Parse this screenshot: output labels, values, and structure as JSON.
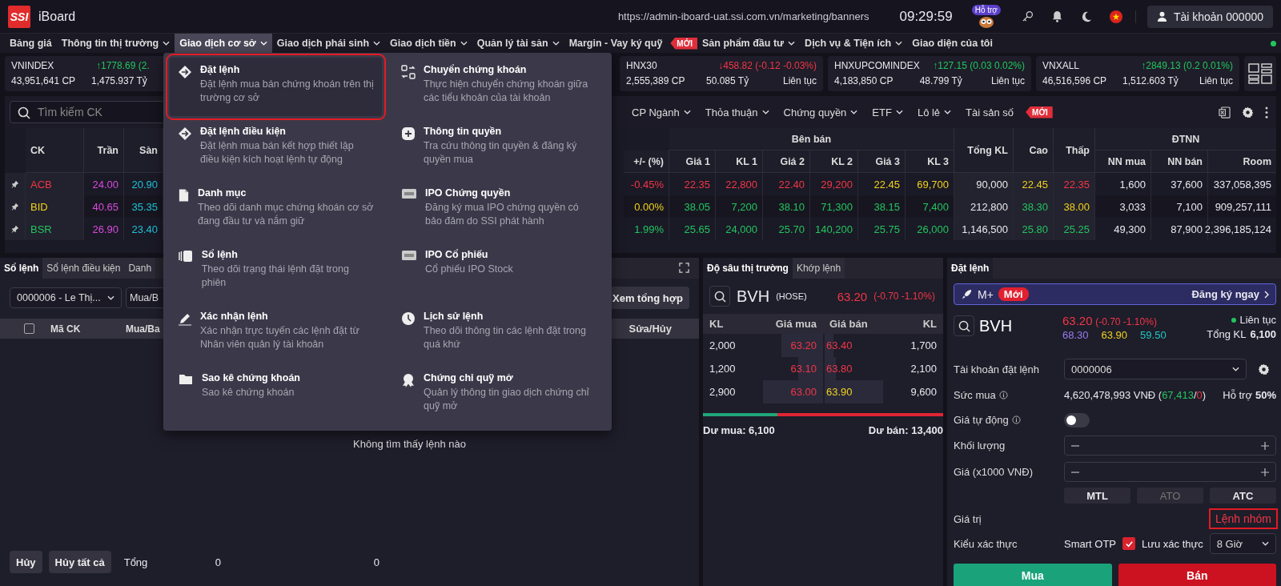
{
  "header": {
    "logo": "SSI",
    "app_name": "iBoard",
    "url": "https://admin-iboard-uat.ssi.com.vn/marketing/banners",
    "time": "09:29:59",
    "support_label": "Hỗ trợ",
    "account": "Tài khoản 000000"
  },
  "nav": [
    {
      "label": "Bảng giá",
      "dropdown": false,
      "selected": false
    },
    {
      "label": "Thông tin thị trường",
      "dropdown": true,
      "selected": false
    },
    {
      "label": "Giao dịch cơ sở",
      "dropdown": true,
      "selected": true
    },
    {
      "label": "Giao dịch phái sinh",
      "dropdown": true,
      "selected": false
    },
    {
      "label": "Giao dịch tiền",
      "dropdown": true,
      "selected": false
    },
    {
      "label": "Quản lý tài sản",
      "dropdown": true,
      "selected": false
    },
    {
      "label": "Margin - Vay ký quỹ",
      "dropdown": false,
      "selected": false,
      "badge": "MỚI"
    },
    {
      "label": "Sản phẩm đầu tư",
      "dropdown": true,
      "selected": false
    },
    {
      "label": "Dịch vụ & Tiện ích",
      "dropdown": true,
      "selected": false
    },
    {
      "label": "Giao diện của tôi",
      "dropdown": false,
      "selected": false
    }
  ],
  "indices": [
    {
      "name": "VNINDEX",
      "change": "↑1778.69 (2.",
      "color": "#22c55e",
      "volume": "43,951,641 CP",
      "value": "1,475.937 Tỷ"
    },
    {
      "name": "HNX30",
      "change": "↓458.82 (-0.12 -0.03%)",
      "color": "#f23645",
      "volume": "2,555,389 CP",
      "value": "50.085 Tỷ",
      "session": "Liên tục"
    },
    {
      "name": "HNXUPCOMINDEX",
      "change": "↑127.15 (0.03 0.02%)",
      "color": "#22c55e",
      "volume": "4,183,850 CP",
      "value": "48.799 Tỷ",
      "session": "Liên tục"
    },
    {
      "name": "VNXALL",
      "change": "↑2849.13 (0.2 0.01%)",
      "color": "#22c55e",
      "volume": "46,516,596 CP",
      "value": "1,512.603 Tỷ",
      "session": "Liên tục"
    }
  ],
  "board_toolbar": {
    "search_placeholder": "Tìm kiếm CK",
    "filters": [
      {
        "label": "CP Ngành",
        "dropdown": true
      },
      {
        "label": "Thỏa thuận",
        "dropdown": true
      },
      {
        "label": "Chứng quyền",
        "dropdown": true
      },
      {
        "label": "ETF",
        "dropdown": true
      },
      {
        "label": "Lô lẻ",
        "dropdown": true
      },
      {
        "label": "Tài sản số",
        "dropdown": false,
        "badge": "MỚI"
      }
    ]
  },
  "price_table": {
    "left_columns": [
      "CK",
      "Trần",
      "Sàn"
    ],
    "header": [
      {
        "kind": "sub",
        "label": "+/- (%)"
      },
      {
        "kind": "group",
        "label": "Bên bán",
        "columns": [
          "Giá 1",
          "KL 1",
          "Giá 2",
          "KL 2",
          "Giá 3",
          "KL 3"
        ]
      },
      {
        "kind": "tall",
        "label": "Tổng KL"
      },
      {
        "kind": "tall",
        "label": "Cao"
      },
      {
        "kind": "tall",
        "label": "Thấp"
      },
      {
        "kind": "group",
        "label": "ĐTNN",
        "columns": [
          "NN mua",
          "NN bán",
          "Room"
        ]
      }
    ],
    "rows": [
      {
        "symbol": "ACB",
        "color": "#f23645",
        "left": [
          {
            "text": "24.00",
            "color": "#d84bdc"
          },
          {
            "text": "20.90",
            "color": "#1ec3d8"
          }
        ],
        "right": [
          {
            "text": "-0.45%",
            "color": "#f23645"
          },
          {
            "text": "22.35",
            "color": "#f23645"
          },
          {
            "text": "22,800",
            "color": "#f23645"
          },
          {
            "text": "22.40",
            "color": "#f23645"
          },
          {
            "text": "29,200",
            "color": "#f23645"
          },
          {
            "text": "22.45",
            "color": "#f0d21b"
          },
          {
            "text": "69,700",
            "color": "#f0d21b"
          },
          {
            "text": "90,000",
            "color": "#e8e8ee"
          },
          {
            "text": "22.45",
            "color": "#f0d21b"
          },
          {
            "text": "22.35",
            "color": "#f23645"
          },
          {
            "text": "1,600",
            "color": "#e8e8ee"
          },
          {
            "text": "37,600",
            "color": "#e8e8ee"
          },
          {
            "text": "337,058,395",
            "color": "#e8e8ee"
          }
        ]
      },
      {
        "symbol": "BID",
        "color": "#f0d21b",
        "left": [
          {
            "text": "40.65",
            "color": "#d84bdc"
          },
          {
            "text": "35.35",
            "color": "#1ec3d8"
          }
        ],
        "right": [
          {
            "text": "0.00%",
            "color": "#f0d21b"
          },
          {
            "text": "38.05",
            "color": "#22c55e"
          },
          {
            "text": "7,200",
            "color": "#22c55e"
          },
          {
            "text": "38.10",
            "color": "#22c55e"
          },
          {
            "text": "71,300",
            "color": "#22c55e"
          },
          {
            "text": "38.15",
            "color": "#22c55e"
          },
          {
            "text": "7,400",
            "color": "#22c55e"
          },
          {
            "text": "212,800",
            "color": "#e8e8ee"
          },
          {
            "text": "38.30",
            "color": "#22c55e"
          },
          {
            "text": "38.00",
            "color": "#f0d21b"
          },
          {
            "text": "3,033",
            "color": "#e8e8ee"
          },
          {
            "text": "7,100",
            "color": "#e8e8ee"
          },
          {
            "text": "909,257,111",
            "color": "#e8e8ee"
          }
        ]
      },
      {
        "symbol": "BSR",
        "color": "#22c55e",
        "left": [
          {
            "text": "26.90",
            "color": "#d84bdc"
          },
          {
            "text": "23.40",
            "color": "#1ec3d8"
          }
        ],
        "right": [
          {
            "text": "1.99%",
            "color": "#22c55e"
          },
          {
            "text": "25.65",
            "color": "#22c55e"
          },
          {
            "text": "24,000",
            "color": "#22c55e"
          },
          {
            "text": "25.70",
            "color": "#22c55e"
          },
          {
            "text": "140,200",
            "color": "#22c55e"
          },
          {
            "text": "25.75",
            "color": "#22c55e"
          },
          {
            "text": "26,000",
            "color": "#22c55e"
          },
          {
            "text": "1,146,500",
            "color": "#e8e8ee"
          },
          {
            "text": "25.80",
            "color": "#22c55e"
          },
          {
            "text": "25.25",
            "color": "#22c55e"
          },
          {
            "text": "49,300",
            "color": "#e8e8ee"
          },
          {
            "text": "87,900",
            "color": "#e8e8ee"
          },
          {
            "text": "2,396,185,124",
            "color": "#e8e8ee"
          }
        ]
      }
    ]
  },
  "menu": {
    "columns": [
      [
        {
          "kind": "diamond-arrow",
          "title": "Đặt lệnh",
          "desc": "Đặt lệnh mua bán chứng khoán trên thị trường cơ sở",
          "selected": true
        },
        {
          "kind": "diamond-arrow",
          "title": "Đặt lệnh điều kiện",
          "desc": "Đặt lệnh mua bán kết hợp thiết lập điều kiện kích hoạt lệnh tự động",
          "selected": false
        },
        {
          "kind": "document",
          "title": "Danh mục",
          "desc": "Theo dõi danh mục chứng khoán cơ sở đang đầu tư và nắm giữ",
          "selected": false
        },
        {
          "kind": "book",
          "title": "Sổ lệnh",
          "desc": "Theo dõi trạng thái lệnh đặt trong phiên",
          "selected": false
        },
        {
          "kind": "pen",
          "title": "Xác nhận lệnh",
          "desc": "Xác nhận trực tuyến các lệnh đặt từ Nhân viên quản lý tài khoản",
          "selected": false
        },
        {
          "kind": "folder",
          "title": "Sao kê chứng khoán",
          "desc": "Sao kê chứng khoán",
          "selected": false
        }
      ],
      [
        {
          "kind": "transfer",
          "title": "Chuyển chứng khoán",
          "desc": "Thực hiện chuyển chứng khoán giữa các tiểu khoản của tài khoản",
          "selected": false
        },
        {
          "kind": "plus",
          "title": "Thông tin quyền",
          "desc": "Tra cứu thông tin quyền & đăng ký quyền mua",
          "selected": false
        },
        {
          "kind": "ticket",
          "title": "IPO Chứng quyền",
          "desc": "Đăng ký mua IPO chứng quyền có bảo đảm do SSI phát hành",
          "selected": false
        },
        {
          "kind": "ticket",
          "title": "IPO Cổ phiếu",
          "desc": "Cổ phiếu IPO Stock",
          "selected": false
        },
        {
          "kind": "clock",
          "title": "Lịch sử lệnh",
          "desc": "Theo dõi thông tin các lệnh đặt trong quá khứ",
          "selected": false
        },
        {
          "kind": "medal",
          "title": "Chứng chỉ quỹ mở",
          "desc": "Quản lý thông tin giao dịch chứng chỉ quỹ mở",
          "selected": false
        }
      ]
    ]
  },
  "order_book": {
    "tabs": [
      {
        "label": "Sổ lệnh",
        "selected": true
      },
      {
        "label": "Sổ lệnh điều kiện",
        "selected": false
      },
      {
        "label": "Danh",
        "selected": false
      }
    ],
    "account_select": "0000006 - Le Thị...",
    "side_select": "Mua/B",
    "summary_button": "Xem tổng hợp",
    "select_all_checked": false,
    "columns": [
      "Mã CK",
      "Mua/Ba"
    ],
    "last_column": "Sửa/Hủy",
    "empty_message": "Không tìm thấy lệnh nào",
    "cancel_button": "Hủy",
    "cancel_all_button": "Hủy tất cả",
    "total_label": "Tổng",
    "totals": [
      "0",
      "0"
    ]
  },
  "depth": {
    "tabs": [
      {
        "label": "Độ sâu thị trường",
        "selected": true
      },
      {
        "label": "Khớp lệnh",
        "selected": false
      }
    ],
    "symbol": "BVH",
    "exchange": "(HOSE)",
    "price": "63.20",
    "change": "(-0.70 -1.10%)",
    "color": "#f23645",
    "columns": [
      "KL",
      "Giá mua",
      "Giá bán",
      "KL"
    ],
    "rows": [
      {
        "bid_volume": "2,000",
        "bid": {
          "price": "63.20",
          "color": "#f23645"
        },
        "ask": {
          "price": "63.40",
          "color": "#f23645"
        },
        "ask_volume": "1,700"
      },
      {
        "bid_volume": "1,200",
        "bid": {
          "price": "63.10",
          "color": "#f23645"
        },
        "ask": {
          "price": "63.80",
          "color": "#f23645"
        },
        "ask_volume": "2,100"
      },
      {
        "bid_volume": "2,900",
        "bid": {
          "price": "63.00",
          "color": "#f23645"
        },
        "ask": {
          "price": "63.90",
          "color": "#f0d21b"
        },
        "ask_volume": "9,600"
      }
    ],
    "balance": {
      "level": 0.31
    },
    "buy_surplus": "Dư mua: 6,100",
    "sell_surplus": "Dư bán: 13,400"
  },
  "order_form": {
    "tab": "Đặt lệnh",
    "promo": {
      "brand": "M+",
      "badge": "Mới",
      "cta": "Đăng ký ngay"
    },
    "symbol": "BVH",
    "price": "63.20",
    "change": "(-0.70 -1.10%)",
    "color": "#f23645",
    "ceiling": "68.30",
    "reference": "63.90",
    "floor": "59.50",
    "session": "Liên tục",
    "total_label": "Tổng KL",
    "total": "6,100",
    "rows": [
      {
        "kind": "select",
        "label": "Tài khoản đặt lệnh",
        "value": "0000006"
      },
      {
        "kind": "buying_power",
        "label": "Sức mua",
        "info": true,
        "parts": [
          {
            "text": "4,620,478,993 VNĐ ("
          },
          {
            "text": "67,413",
            "color": "#22c55e"
          },
          {
            "text": "/"
          },
          {
            "text": "0",
            "color": "#f23645"
          },
          {
            "text": ")"
          }
        ],
        "support_label": "Hỗ trợ",
        "support_value": "50%"
      },
      {
        "kind": "toggle",
        "label": "Giá tự động",
        "info": true,
        "on": false
      },
      {
        "kind": "stepper",
        "label": "Khối lượng"
      },
      {
        "kind": "stepper",
        "label": "Giá (x1000 VNĐ)"
      },
      {
        "kind": "price_types",
        "options": [
          {
            "label": "MTL",
            "disabled": false
          },
          {
            "label": "ATO",
            "disabled": true
          },
          {
            "label": "ATC",
            "disabled": false
          }
        ]
      },
      {
        "kind": "value",
        "label": "Giá trị",
        "link": "Lệnh nhóm",
        "highlighted": true
      },
      {
        "kind": "auth",
        "label": "Kiểu xác thực",
        "method": "Smart OTP",
        "remember_label": "Lưu xác thực",
        "remember": true,
        "duration": "8 Giờ"
      }
    ],
    "buy_button": "Mua",
    "sell_button": "Bán"
  }
}
